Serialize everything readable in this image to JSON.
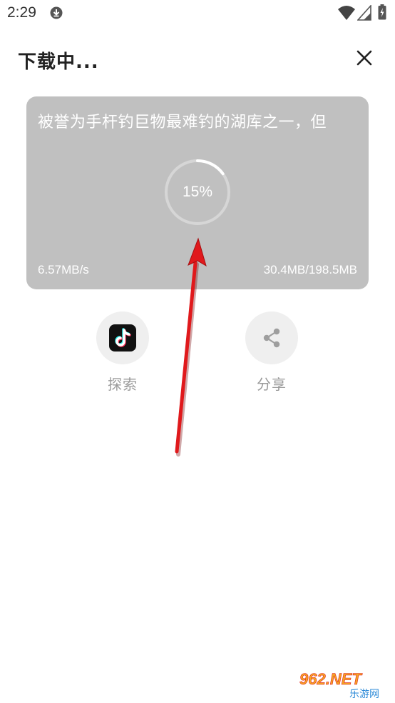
{
  "status_bar": {
    "time": "2:29",
    "icons": [
      "download-icon",
      "wifi-icon",
      "signal-icon",
      "battery-icon"
    ]
  },
  "header": {
    "title": "下载中...",
    "close_icon": "close-icon"
  },
  "download_card": {
    "video_title": "被誉为手杆钓巨物最难钓的湖库之一，但",
    "progress_percent": 15,
    "progress_text": "15%",
    "speed": "6.57MB/s",
    "size": "30.4MB/198.5MB",
    "background_color": "#c0c0c0"
  },
  "actions": [
    {
      "label": "探索",
      "icon": "tiktok-icon"
    },
    {
      "label": "分享",
      "icon": "share-icon"
    }
  ],
  "annotation": {
    "color": "#e0191c",
    "icon": "red-arrow"
  },
  "watermark": {
    "text_top": "962.NET",
    "text_bottom": "乐游网"
  }
}
